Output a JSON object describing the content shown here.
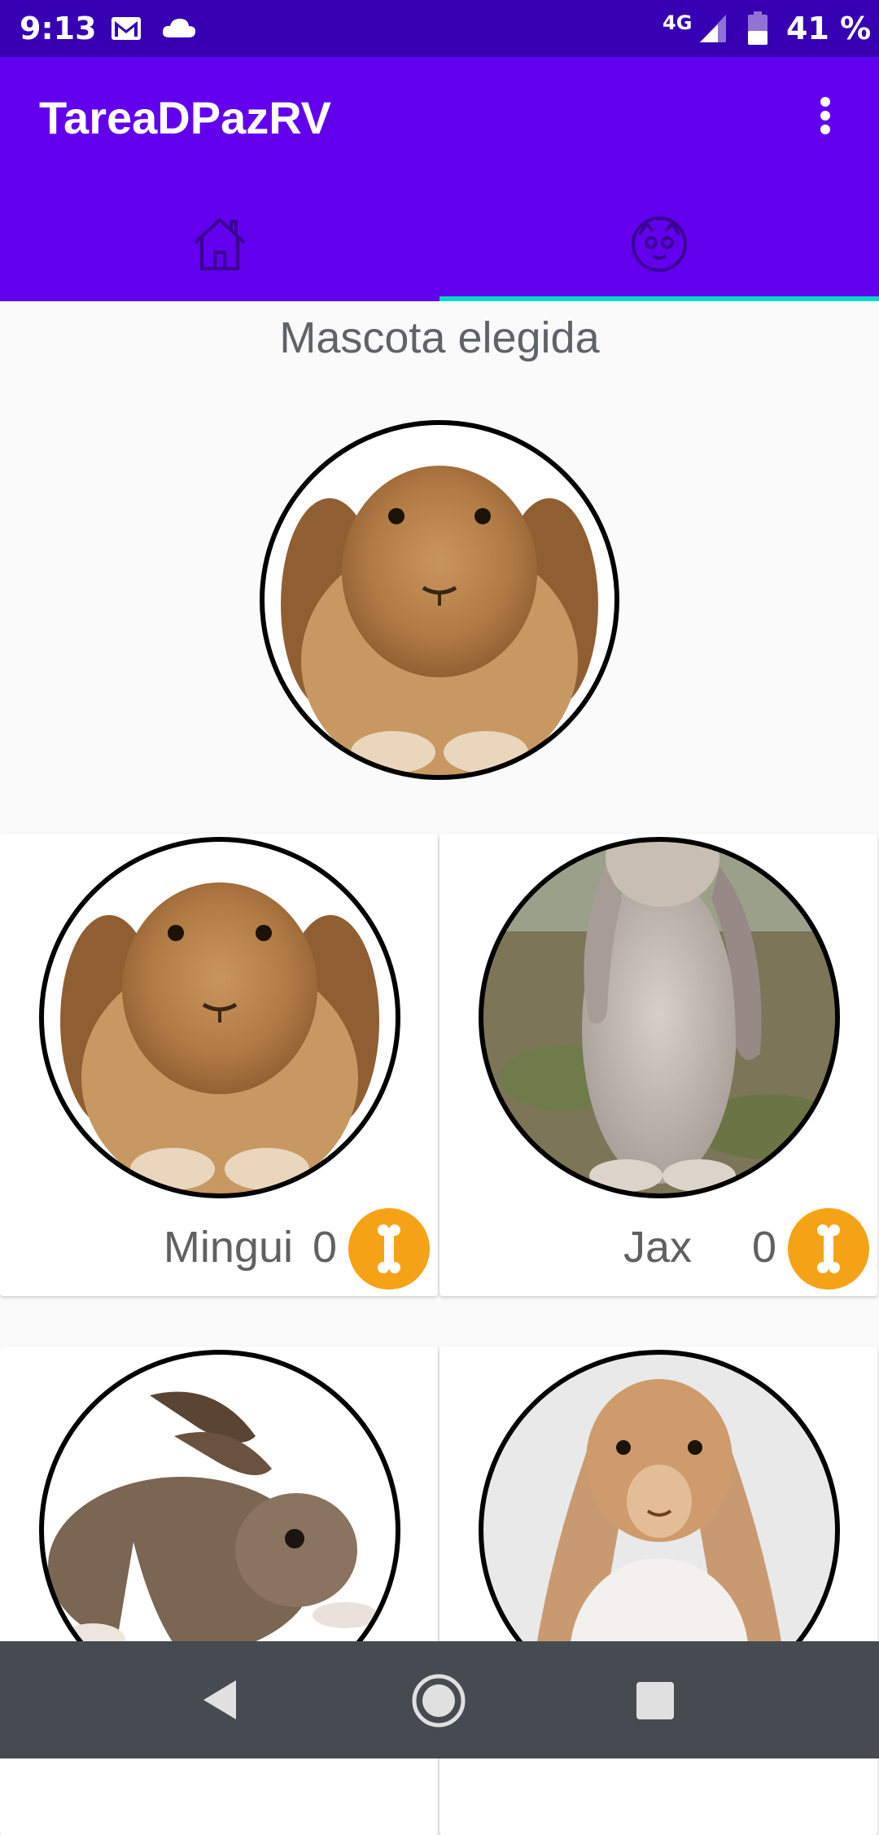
{
  "status_bar": {
    "time": "9:13",
    "network": "4G",
    "battery": "41 %",
    "icons": [
      "gmail-icon",
      "cloud-icon",
      "signal-icon",
      "battery-icon"
    ]
  },
  "app_bar": {
    "title": "TareaDPazRV",
    "tabs": [
      {
        "icon": "home-icon",
        "selected": false
      },
      {
        "icon": "pet-face-icon",
        "selected": true
      }
    ],
    "colors": {
      "primary": "#6200ee",
      "primary_dark": "#3700b3",
      "indicator": "#03dac5"
    }
  },
  "main": {
    "chosen_title": "Mascota elegida",
    "pets": [
      {
        "name": "Mingui",
        "likes": "0"
      },
      {
        "name": "Jax",
        "likes": "0"
      },
      {
        "name": "",
        "likes": ""
      },
      {
        "name": "",
        "likes": ""
      }
    ],
    "like_color": "#f5a316"
  },
  "nav_bar": {
    "icons": [
      "back-icon",
      "home-circle-icon",
      "recents-icon"
    ]
  }
}
